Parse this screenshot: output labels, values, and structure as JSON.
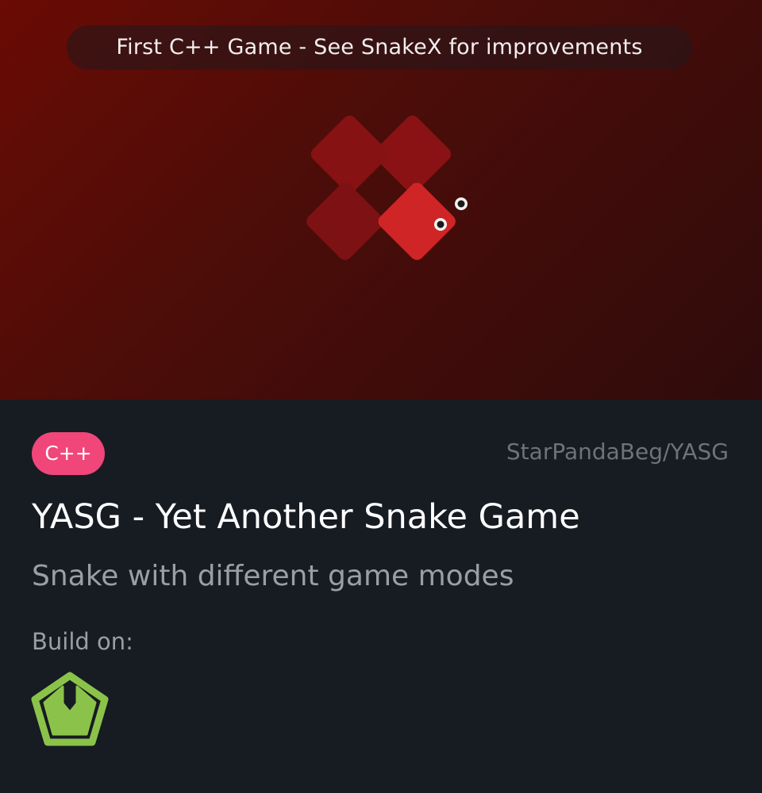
{
  "banner": {
    "note": "First C++ Game - See SnakeX for improvements",
    "logo_icon": "snake-diamond-logo-icon",
    "colors": {
      "background": "#5a0d07",
      "tile": "#8a1214",
      "head": "#cf2526"
    }
  },
  "project": {
    "language": "C++",
    "language_color": "#f0467a",
    "repo": "StarPandaBeg/YASG",
    "title": "YASG - Yet Another Snake Game",
    "description": "Snake with different game modes",
    "build_label": "Build on:",
    "build_tools": [
      {
        "icon": "spring-logo-icon",
        "color": "#8bc34a"
      }
    ]
  }
}
